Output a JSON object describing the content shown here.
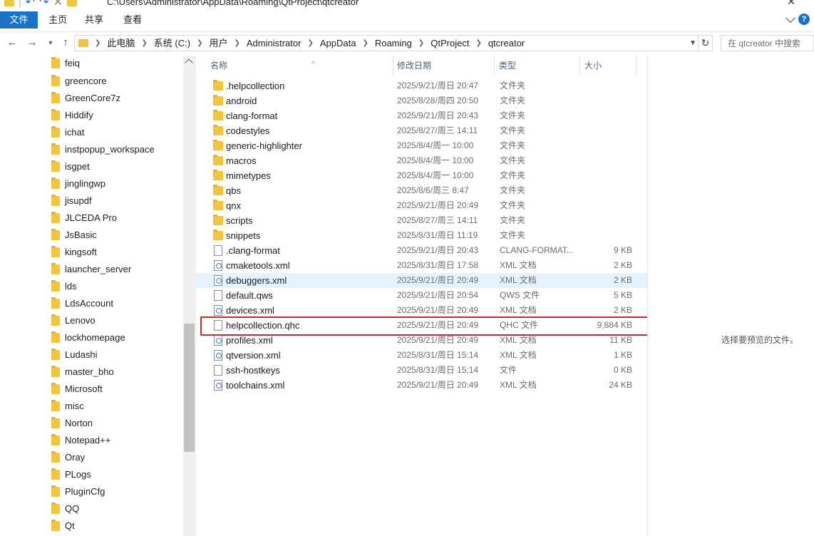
{
  "window": {
    "title_path": "C:\\Users\\Administrator\\AppData\\Roaming\\QtProject\\qtcreator"
  },
  "ribbon": {
    "tabs": [
      "文件",
      "主页",
      "共享",
      "查看"
    ]
  },
  "address": {
    "crumbs": [
      "此电脑",
      "系统 (C:)",
      "用户",
      "Administrator",
      "AppData",
      "Roaming",
      "QtProject",
      "qtcreator"
    ]
  },
  "search": {
    "placeholder": "在 qtcreator 中搜索"
  },
  "nav_pane": {
    "items": [
      "feiq",
      "greencore",
      "GreenCore7z",
      "Hiddify",
      "ichat",
      "instpopup_workspace",
      "isgpet",
      "jinglingwp",
      "jisupdf",
      "JLCEDA Pro",
      "JsBasic",
      "kingsoft",
      "launcher_server",
      "lds",
      "LdsAccount",
      "Lenovo",
      "lockhomepage",
      "Ludashi",
      "master_bho",
      "Microsoft",
      "misc",
      "Norton",
      "Notepad++",
      "Oray",
      "PLogs",
      "PluginCfg",
      "QQ",
      "Qt"
    ]
  },
  "file_list": {
    "columns": {
      "name": "名称",
      "date": "修改日期",
      "type": "类型",
      "size": "大小"
    },
    "rows": [
      {
        "name": ".helpcollection",
        "date": "2025/9/21/周日 20:47",
        "type": "文件夹",
        "size": "",
        "icon": "folder"
      },
      {
        "name": "android",
        "date": "2025/8/28/周四 20:50",
        "type": "文件夹",
        "size": "",
        "icon": "folder"
      },
      {
        "name": "clang-format",
        "date": "2025/9/21/周日 20:43",
        "type": "文件夹",
        "size": "",
        "icon": "folder"
      },
      {
        "name": "codestyles",
        "date": "2025/8/27/周三 14:11",
        "type": "文件夹",
        "size": "",
        "icon": "folder"
      },
      {
        "name": "generic-highlighter",
        "date": "2025/8/4/周一 10:00",
        "type": "文件夹",
        "size": "",
        "icon": "folder"
      },
      {
        "name": "macros",
        "date": "2025/8/4/周一 10:00",
        "type": "文件夹",
        "size": "",
        "icon": "folder"
      },
      {
        "name": "mimetypes",
        "date": "2025/8/4/周一 10:00",
        "type": "文件夹",
        "size": "",
        "icon": "folder"
      },
      {
        "name": "qbs",
        "date": "2025/8/6/周三 8:47",
        "type": "文件夹",
        "size": "",
        "icon": "folder"
      },
      {
        "name": "qnx",
        "date": "2025/9/21/周日 20:49",
        "type": "文件夹",
        "size": "",
        "icon": "folder"
      },
      {
        "name": "scripts",
        "date": "2025/8/27/周三 14:11",
        "type": "文件夹",
        "size": "",
        "icon": "folder"
      },
      {
        "name": "snippets",
        "date": "2025/8/31/周日 11:19",
        "type": "文件夹",
        "size": "",
        "icon": "folder"
      },
      {
        "name": ".clang-format",
        "date": "2025/9/21/周日 20:43",
        "type": "CLANG-FORMAT...",
        "size": "9 KB",
        "icon": "file"
      },
      {
        "name": "cmaketools.xml",
        "date": "2025/8/31/周日 17:58",
        "type": "XML 文档",
        "size": "2 KB",
        "icon": "xml"
      },
      {
        "name": "debuggers.xml",
        "date": "2025/9/21/周日 20:49",
        "type": "XML 文档",
        "size": "2 KB",
        "icon": "xml"
      },
      {
        "name": "default.qws",
        "date": "2025/9/21/周日 20:54",
        "type": "QWS 文件",
        "size": "5 KB",
        "icon": "file"
      },
      {
        "name": "devices.xml",
        "date": "2025/9/21/周日 20:49",
        "type": "XML 文档",
        "size": "2 KB",
        "icon": "xml"
      },
      {
        "name": "helpcollection.qhc",
        "date": "2025/9/21/周日 20:49",
        "type": "QHC 文件",
        "size": "9,884 KB",
        "icon": "file"
      },
      {
        "name": "profiles.xml",
        "date": "2025/9/21/周日 20:49",
        "type": "XML 文档",
        "size": "11 KB",
        "icon": "xml"
      },
      {
        "name": "qtversion.xml",
        "date": "2025/8/31/周日 15:14",
        "type": "XML 文档",
        "size": "1 KB",
        "icon": "xml"
      },
      {
        "name": "ssh-hostkeys",
        "date": "2025/8/31/周日 15:14",
        "type": "文件",
        "size": "0 KB",
        "icon": "file"
      },
      {
        "name": "toolchains.xml",
        "date": "2025/9/21/周日 20:49",
        "type": "XML 文档",
        "size": "24 KB",
        "icon": "xml"
      }
    ]
  },
  "preview": {
    "message": "选择要预览的文件。"
  }
}
